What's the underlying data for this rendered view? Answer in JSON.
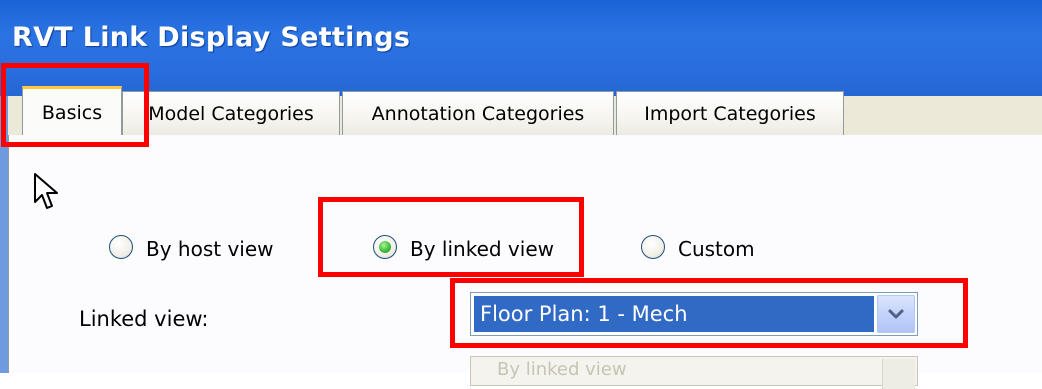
{
  "window": {
    "title": "RVT Link Display Settings"
  },
  "tabs": [
    {
      "label": "Basics",
      "active": true
    },
    {
      "label": "Model Categories",
      "active": false
    },
    {
      "label": "Annotation Categories",
      "active": false
    },
    {
      "label": "Import Categories",
      "active": false
    }
  ],
  "options": [
    {
      "label": "By host view",
      "selected": false
    },
    {
      "label": "By linked view",
      "selected": true
    },
    {
      "label": "Custom",
      "selected": false
    }
  ],
  "linked_view": {
    "label": "Linked view:",
    "value": "Floor Plan: 1 - Mech"
  },
  "second_dropdown": {
    "partial_text": "By linked view"
  },
  "colors": {
    "titlebar": "#2b73e2",
    "highlight": "#ff0000",
    "selection": "#316ac5",
    "radio_selected": "#3fbf3a"
  },
  "icons": [
    "mouse-cursor-icon",
    "chevron-down-icon"
  ]
}
